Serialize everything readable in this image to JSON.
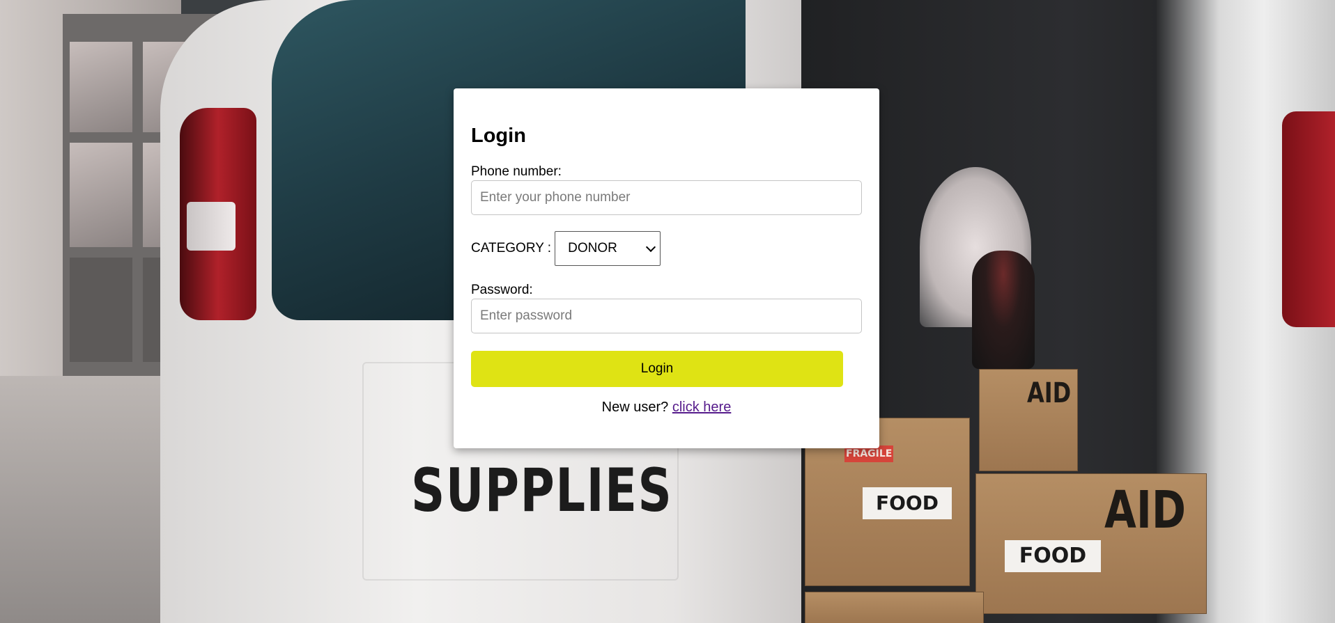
{
  "background": {
    "door_lettering": "SUPPLIES",
    "box_labels": [
      "FOOD",
      "FOOD",
      "AID",
      "AID",
      "FRAGILE"
    ]
  },
  "login": {
    "title": "Login",
    "phone_label": "Phone number:",
    "phone_placeholder": "Enter your phone number",
    "category_label": "CATEGORY :",
    "category_selected": "DONOR",
    "password_label": "Password:",
    "password_placeholder": "Enter password",
    "submit_label": "Login",
    "new_user_text": "New user?",
    "signup_link": "click here"
  },
  "colors": {
    "button": "#dfe314",
    "link_visited": "#551a8b",
    "card": "#ffffff"
  }
}
